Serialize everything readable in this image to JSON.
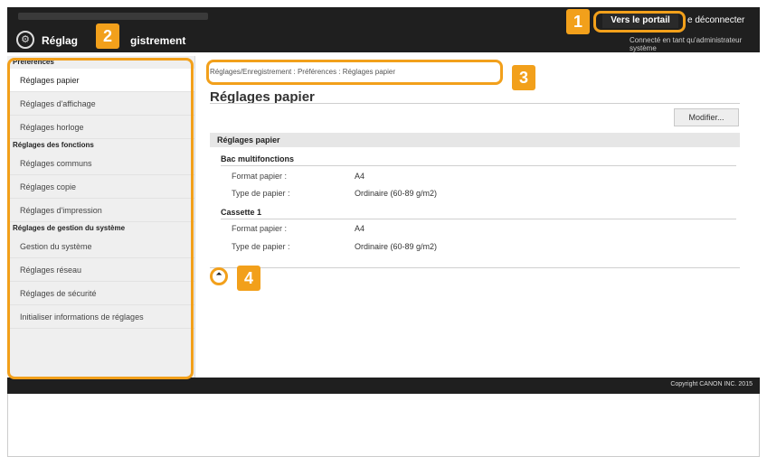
{
  "header": {
    "app_logo": "settings-icon",
    "app_title_part1": "Réglag",
    "app_title_part2": "gistrement",
    "portal_link": "Vers le portail",
    "logout_link": "e déconnecter",
    "admin_label": "Connecté en tant qu'administrateur système"
  },
  "sidebar": {
    "sections": [
      {
        "title": "Préférences",
        "items": [
          {
            "label": "Réglages papier",
            "active": true
          },
          {
            "label": "Réglages d'affichage",
            "active": false
          },
          {
            "label": "Réglages horloge",
            "active": false
          }
        ]
      },
      {
        "title": "Réglages des fonctions",
        "items": [
          {
            "label": "Réglages communs",
            "active": false
          },
          {
            "label": "Réglages copie",
            "active": false
          },
          {
            "label": "Réglages d'impression",
            "active": false
          }
        ]
      },
      {
        "title": "Réglages de gestion du système",
        "items": [
          {
            "label": "Gestion du système",
            "active": false
          },
          {
            "label": "Réglages réseau",
            "active": false
          },
          {
            "label": "Réglages de sécurité",
            "active": false
          },
          {
            "label": "Initialiser informations de réglages",
            "active": false
          }
        ]
      }
    ]
  },
  "main": {
    "breadcrumb": "Réglages/Enregistrement : Préférences : Réglages papier",
    "page_title": "Réglages papier",
    "modify_button": "Modifier...",
    "section_title": "Réglages papier",
    "groups": [
      {
        "title": "Bac multifonctions",
        "rows": [
          {
            "label": "Format papier :",
            "value": "A4"
          },
          {
            "label": "Type de papier :",
            "value": "Ordinaire (60-89 g/m2)"
          }
        ]
      },
      {
        "title": "Cassette 1",
        "rows": [
          {
            "label": "Format papier :",
            "value": "A4"
          },
          {
            "label": "Type de papier :",
            "value": "Ordinaire (60-89 g/m2)"
          }
        ]
      }
    ],
    "top_arrow": "⏶"
  },
  "footer": {
    "copyright": "Copyright CANON INC. 2015"
  },
  "callouts": [
    "1",
    "2",
    "3",
    "4"
  ],
  "colors": {
    "accent": "#f2a01b",
    "header_bg": "#1f1f1f",
    "sidebar_bg": "#efefef"
  }
}
